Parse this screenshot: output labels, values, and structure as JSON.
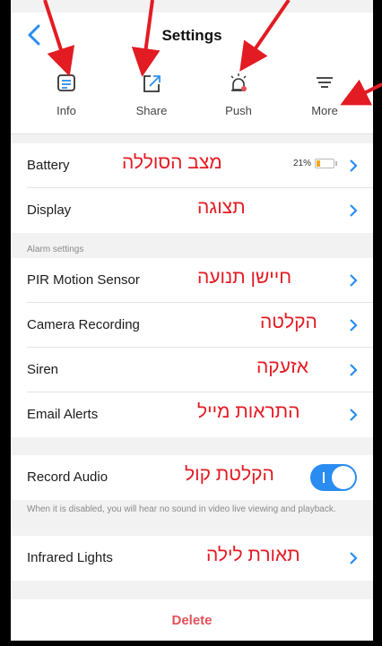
{
  "nav": {
    "title": "Settings"
  },
  "actions": [
    {
      "label": "Info",
      "icon": "info-icon"
    },
    {
      "label": "Share",
      "icon": "share-icon"
    },
    {
      "label": "Push",
      "icon": "alarm-bell-icon"
    },
    {
      "label": "More",
      "icon": "menu-icon"
    }
  ],
  "rows": {
    "battery": {
      "label": "Battery",
      "hebrew": "מצב הסוללה",
      "percent_text": "21%",
      "level": 0.21
    },
    "display": {
      "label": "Display",
      "hebrew": "תצוגה"
    },
    "alarm_section_title": "Alarm settings",
    "pir": {
      "label": "PIR Motion Sensor",
      "hebrew": "חיישן תנועה"
    },
    "recording": {
      "label": "Camera Recording",
      "hebrew": "הקלטה"
    },
    "siren": {
      "label": "Siren",
      "hebrew": "אזעקה"
    },
    "email": {
      "label": "Email Alerts",
      "hebrew": "התראות מייל"
    },
    "record_audio": {
      "label": "Record Audio",
      "hebrew": "הקלטת קול",
      "enabled": true
    },
    "record_audio_note": "When it is disabled, you will hear no sound in video live viewing and playback.",
    "infrared": {
      "label": "Infrared Lights",
      "hebrew": "תאורת לילה"
    }
  },
  "delete_label": "Delete",
  "colors": {
    "accent": "#2a8cf0",
    "annotation": "#e31b23",
    "delete": "#e2525a",
    "battery": "#f5a623"
  }
}
